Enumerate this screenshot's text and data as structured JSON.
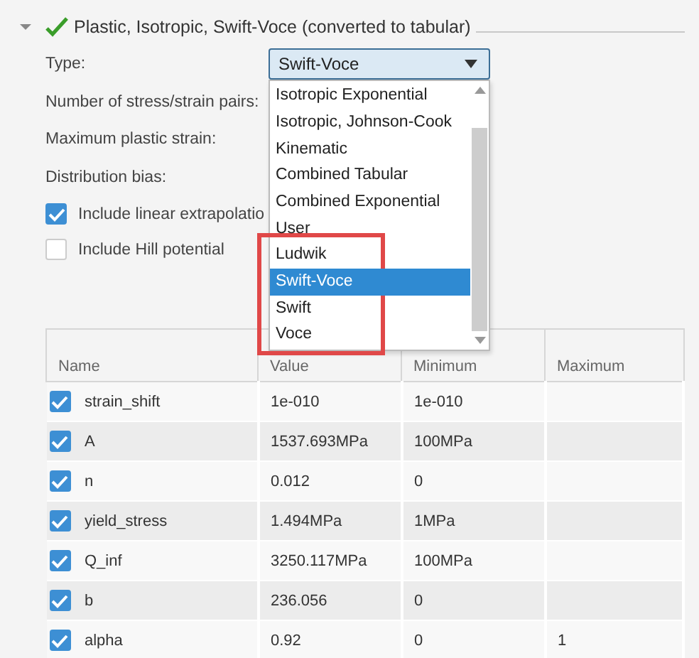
{
  "section": {
    "title": "Plastic, Isotropic, Swift-Voce (converted to tabular)",
    "expanded": true,
    "valid": true
  },
  "type_field": {
    "label": "Type:",
    "value": "Swift-Voce",
    "open": true,
    "options": [
      {
        "label": "Isotropic Exponential",
        "selected": false
      },
      {
        "label": "Isotropic, Johnson-Cook",
        "selected": false
      },
      {
        "label": "Kinematic",
        "selected": false
      },
      {
        "label": "Combined Tabular",
        "selected": false
      },
      {
        "label": "Combined Exponential",
        "selected": false
      },
      {
        "label": "User",
        "selected": false
      },
      {
        "label": "Ludwik",
        "selected": false
      },
      {
        "label": "Swift-Voce",
        "selected": true
      },
      {
        "label": "Swift",
        "selected": false
      },
      {
        "label": "Voce",
        "selected": false
      }
    ]
  },
  "fields": [
    {
      "label": "Number of stress/strain pairs:"
    },
    {
      "label": "Maximum plastic strain:"
    },
    {
      "label": "Distribution bias:"
    }
  ],
  "checkboxes": [
    {
      "label": "Include linear extrapolatio",
      "checked": true
    },
    {
      "label": "Include Hill potential",
      "checked": false
    }
  ],
  "table": {
    "columns": [
      "Name",
      "Value",
      "Minimum",
      "Maximum"
    ],
    "rows": [
      {
        "checked": true,
        "cells": [
          "strain_shift",
          "1e-010",
          "1e-010",
          ""
        ]
      },
      {
        "checked": true,
        "cells": [
          "A",
          "1537.693MPa",
          "100MPa",
          ""
        ]
      },
      {
        "checked": true,
        "cells": [
          "n",
          "0.012",
          "0",
          ""
        ]
      },
      {
        "checked": true,
        "cells": [
          "yield_stress",
          "1.494MPa",
          "1MPa",
          ""
        ]
      },
      {
        "checked": true,
        "cells": [
          "Q_inf",
          "3250.117MPa",
          "100MPa",
          ""
        ]
      },
      {
        "checked": true,
        "cells": [
          "b",
          "236.056",
          "0",
          ""
        ]
      },
      {
        "checked": true,
        "cells": [
          "alpha",
          "0.92",
          "0",
          "1"
        ]
      }
    ]
  }
}
